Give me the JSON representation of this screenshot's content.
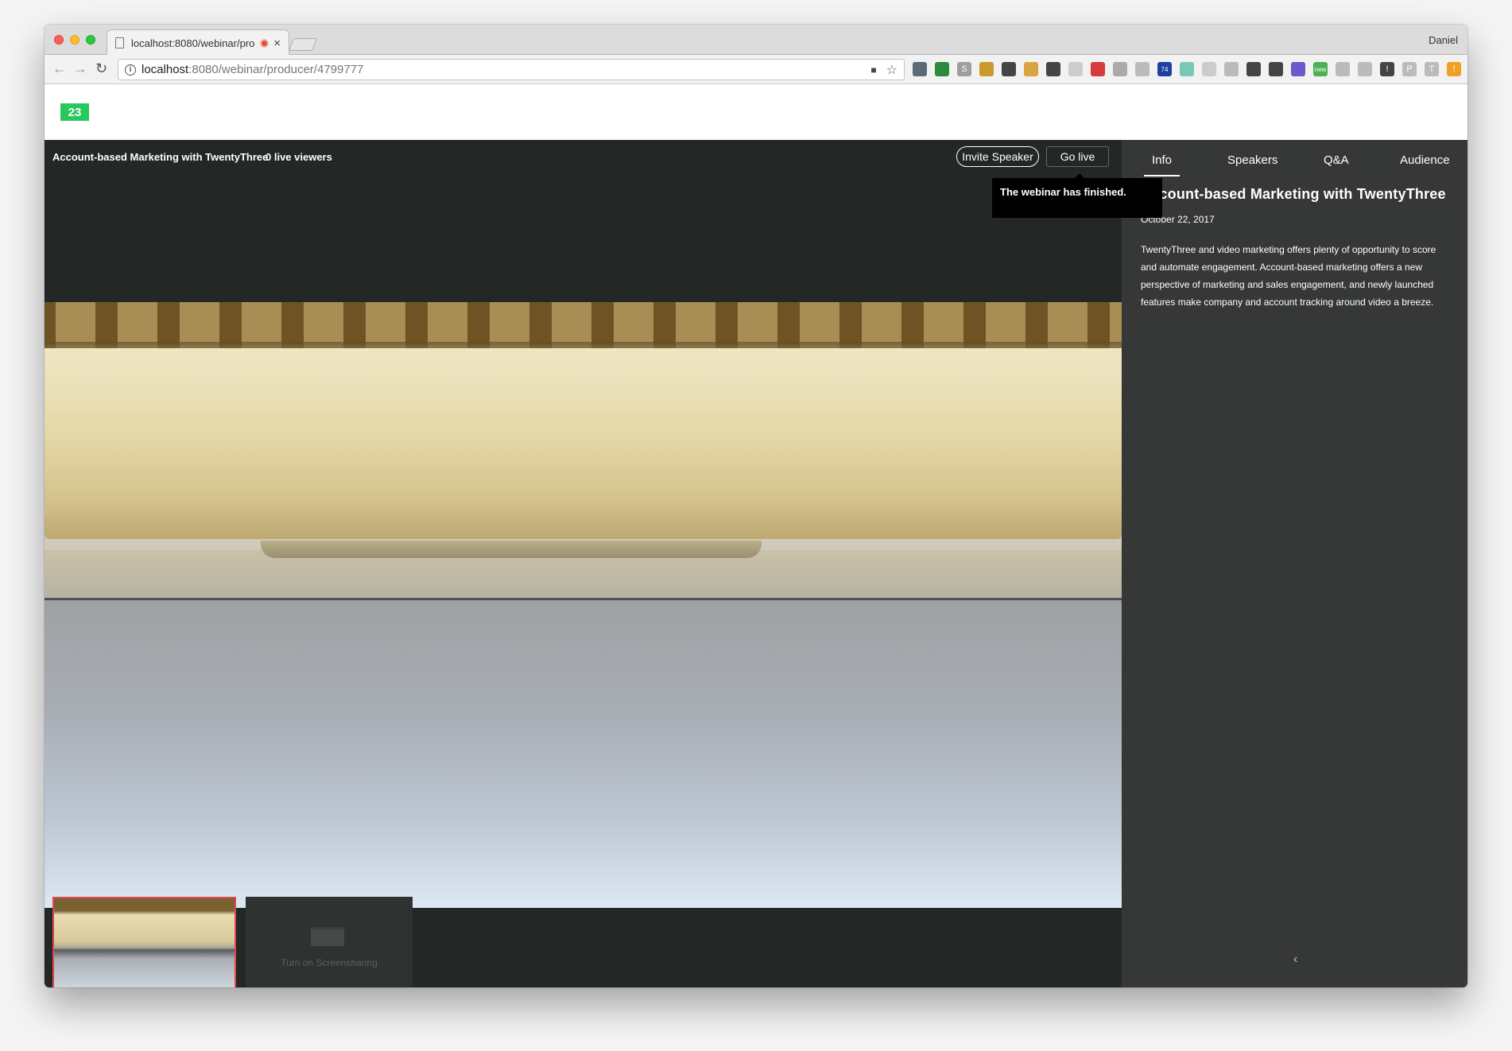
{
  "browser": {
    "tab_title": "localhost:8080/webinar/pro",
    "tab_close": "×",
    "profile_name": "Daniel",
    "url_host": "localhost",
    "url_path": ":8080/webinar/producer/4799777",
    "nav_back": "←",
    "nav_forward": "→",
    "nav_reload": "↻",
    "info_glyph": "i",
    "camera_glyph": "■",
    "star_glyph": "☆",
    "extensions": [
      {
        "icon": "grid-icon",
        "color": "#5a6b7a",
        "label": ""
      },
      {
        "icon": "bookmark-icon",
        "color": "#2b8a3e",
        "label": ""
      },
      {
        "icon": "s-icon",
        "color": "#9e9e9e",
        "label": "S"
      },
      {
        "icon": "bowl-icon",
        "color": "#c99a2e",
        "label": ""
      },
      {
        "icon": "pocket-icon",
        "color": "#444",
        "label": ""
      },
      {
        "icon": "flag-icon",
        "color": "#d9a441",
        "label": ""
      },
      {
        "icon": "evernote-icon",
        "color": "#444",
        "label": ""
      },
      {
        "icon": "cloud-icon",
        "color": "#ccc",
        "label": ""
      },
      {
        "icon": "gift-icon",
        "color": "#d63a3a",
        "label": ""
      },
      {
        "icon": "doc-icon",
        "color": "#aaa",
        "label": ""
      },
      {
        "icon": "cloud2-icon",
        "color": "#bbb",
        "label": ""
      },
      {
        "icon": "house-icon",
        "color": "#1f3fa0",
        "label": "74"
      },
      {
        "icon": "circle-icon",
        "color": "#7ac7b8",
        "label": ""
      },
      {
        "icon": "leaf-icon",
        "color": "#ccc",
        "label": ""
      },
      {
        "icon": "dropbox-icon",
        "color": "#bbb",
        "label": ""
      },
      {
        "icon": "moon-icon",
        "color": "#444",
        "label": ""
      },
      {
        "icon": "panda-icon",
        "color": "#444",
        "label": ""
      },
      {
        "icon": "calendar-icon",
        "color": "#6a5acd",
        "label": ""
      },
      {
        "icon": "new-icon",
        "color": "#4caf50",
        "label": "new"
      },
      {
        "icon": "check-icon",
        "color": "#bbb",
        "label": ""
      },
      {
        "icon": "bar-icon",
        "color": "#bbb",
        "label": ""
      },
      {
        "icon": "info-icon",
        "color": "#444",
        "label": "!"
      },
      {
        "icon": "p-icon",
        "color": "#bbb",
        "label": "P"
      },
      {
        "icon": "t-icon",
        "color": "#bbb",
        "label": "T"
      },
      {
        "icon": "alert-icon",
        "color": "#f0a020",
        "label": "!"
      }
    ]
  },
  "app": {
    "logo_text": "23",
    "logo_color": "#27c85d"
  },
  "stage": {
    "webinar_title": "Account-based Marketing with TwentyThree",
    "live_viewers": "0 live viewers",
    "invite_speaker_label": "Invite Speaker",
    "go_live_label": "Go live",
    "tooltip": "The webinar has finished.",
    "screenshare_label": "Turn on Screensharing",
    "active_border_color": "#e0464f"
  },
  "panel": {
    "tabs": [
      "Info",
      "Speakers",
      "Q&A",
      "Audience"
    ],
    "active_tab": "Info",
    "event_title": "Account-based Marketing with TwentyThree",
    "event_date": "October 22, 2017",
    "description": "TwentyThree and video marketing offers plenty of opportunity to score and automate engagement. Account-based marketing offers a new perspective of marketing and sales engagement, and newly launched features make company and account tracking around video a breeze.",
    "collapse_glyph": "‹"
  }
}
